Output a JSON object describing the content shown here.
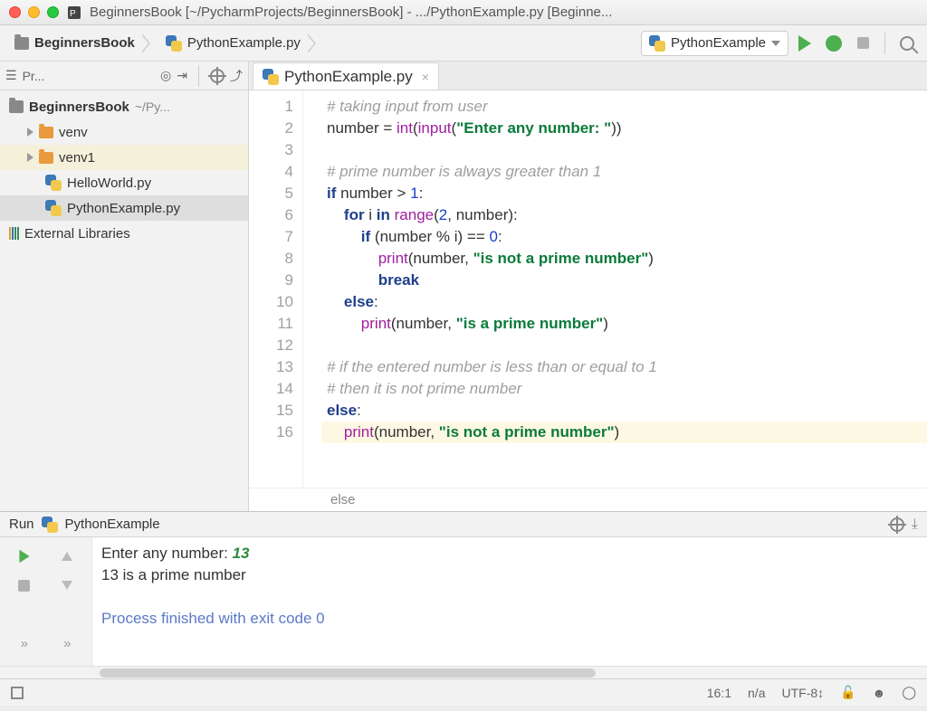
{
  "window": {
    "title": "BeginnersBook [~/PycharmProjects/BeginnersBook] - .../PythonExample.py [Beginne..."
  },
  "breadcrumbs": {
    "project": "BeginnersBook",
    "file": "PythonExample.py"
  },
  "run_config": {
    "selected": "PythonExample"
  },
  "sidebar": {
    "tool_label": "Pr...",
    "project_name": "BeginnersBook",
    "project_path": "~/Py...",
    "items": [
      {
        "label": "venv",
        "kind": "folder"
      },
      {
        "label": "venv1",
        "kind": "folder"
      },
      {
        "label": "HelloWorld.py",
        "kind": "pyfile"
      },
      {
        "label": "PythonExample.py",
        "kind": "pyfile",
        "selected": true
      }
    ],
    "external": "External Libraries"
  },
  "editor": {
    "tab": "PythonExample.py",
    "context_crumb": "else",
    "cursor_line": 16,
    "lines": [
      {
        "n": 1,
        "tokens": [
          {
            "t": "# taking input from user",
            "c": "c-comment"
          }
        ]
      },
      {
        "n": 2,
        "tokens": [
          {
            "t": "number = ",
            "c": "c-op"
          },
          {
            "t": "int",
            "c": "c-fn"
          },
          {
            "t": "(",
            "c": "c-op"
          },
          {
            "t": "input",
            "c": "c-fn"
          },
          {
            "t": "(",
            "c": "c-op"
          },
          {
            "t": "\"Enter any number: \"",
            "c": "c-str"
          },
          {
            "t": "))",
            "c": "c-op"
          }
        ]
      },
      {
        "n": 3,
        "tokens": [
          {
            "t": ""
          }
        ]
      },
      {
        "n": 4,
        "tokens": [
          {
            "t": "# prime number is always greater than 1",
            "c": "c-comment"
          }
        ]
      },
      {
        "n": 5,
        "tokens": [
          {
            "t": "if ",
            "c": "c-kw"
          },
          {
            "t": "number > ",
            "c": "c-op"
          },
          {
            "t": "1",
            "c": "c-num"
          },
          {
            "t": ":",
            "c": "c-op"
          }
        ]
      },
      {
        "n": 6,
        "tokens": [
          {
            "t": "    "
          },
          {
            "t": "for ",
            "c": "c-kw"
          },
          {
            "t": "i ",
            "c": "c-op"
          },
          {
            "t": "in ",
            "c": "c-kw"
          },
          {
            "t": "range",
            "c": "c-fn"
          },
          {
            "t": "(",
            "c": "c-op"
          },
          {
            "t": "2",
            "c": "c-num"
          },
          {
            "t": ", number):",
            "c": "c-op"
          }
        ]
      },
      {
        "n": 7,
        "tokens": [
          {
            "t": "        "
          },
          {
            "t": "if ",
            "c": "c-kw"
          },
          {
            "t": "(number % i) == ",
            "c": "c-op"
          },
          {
            "t": "0",
            "c": "c-num"
          },
          {
            "t": ":",
            "c": "c-op"
          }
        ]
      },
      {
        "n": 8,
        "tokens": [
          {
            "t": "            "
          },
          {
            "t": "print",
            "c": "c-fn"
          },
          {
            "t": "(number, ",
            "c": "c-op"
          },
          {
            "t": "\"is not a prime number\"",
            "c": "c-str"
          },
          {
            "t": ")",
            "c": "c-op"
          }
        ]
      },
      {
        "n": 9,
        "tokens": [
          {
            "t": "            "
          },
          {
            "t": "break",
            "c": "c-kw"
          }
        ]
      },
      {
        "n": 10,
        "tokens": [
          {
            "t": "    "
          },
          {
            "t": "else",
            "c": "c-kw"
          },
          {
            "t": ":",
            "c": "c-op"
          }
        ]
      },
      {
        "n": 11,
        "tokens": [
          {
            "t": "        "
          },
          {
            "t": "print",
            "c": "c-fn"
          },
          {
            "t": "(number, ",
            "c": "c-op"
          },
          {
            "t": "\"is a prime number\"",
            "c": "c-str"
          },
          {
            "t": ")",
            "c": "c-op"
          }
        ]
      },
      {
        "n": 12,
        "tokens": [
          {
            "t": ""
          }
        ]
      },
      {
        "n": 13,
        "tokens": [
          {
            "t": "# if the entered number is less than or equal to 1",
            "c": "c-comment"
          }
        ]
      },
      {
        "n": 14,
        "tokens": [
          {
            "t": "# then it is not prime number",
            "c": "c-comment"
          }
        ]
      },
      {
        "n": 15,
        "tokens": [
          {
            "t": "else",
            "c": "c-kw"
          },
          {
            "t": ":",
            "c": "c-op"
          }
        ]
      },
      {
        "n": 16,
        "tokens": [
          {
            "t": "    "
          },
          {
            "t": "print",
            "c": "c-fn"
          },
          {
            "t": "(number, ",
            "c": "c-op"
          },
          {
            "t": "\"is not a prime number\"",
            "c": "c-str"
          },
          {
            "t": ")",
            "c": "c-op"
          }
        ]
      }
    ]
  },
  "run_tool": {
    "label": "Run",
    "config": "PythonExample",
    "console": {
      "prompt_label": "Enter any number: ",
      "user_input": "13",
      "result": "13 is a prime number",
      "exit": "Process finished with exit code 0"
    }
  },
  "status": {
    "cursor": "16:1",
    "indent": "n/a",
    "encoding": "UTF-8"
  }
}
